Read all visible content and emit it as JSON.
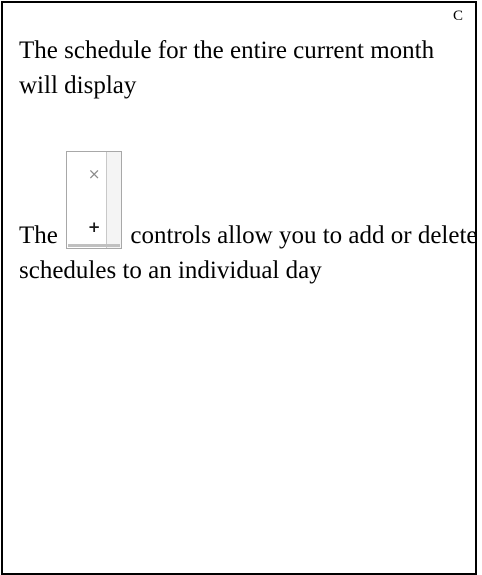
{
  "corner_label": "C",
  "paragraph_1": "The schedule for the entire current month will display",
  "paragraph_2": {
    "lead": "The",
    "rest": "controls allow you to add or delete schedules to an individual day"
  },
  "control": {
    "delete_glyph": "×",
    "add_glyph": "+",
    "delete_icon": "close-icon",
    "add_icon": "plus-icon"
  }
}
